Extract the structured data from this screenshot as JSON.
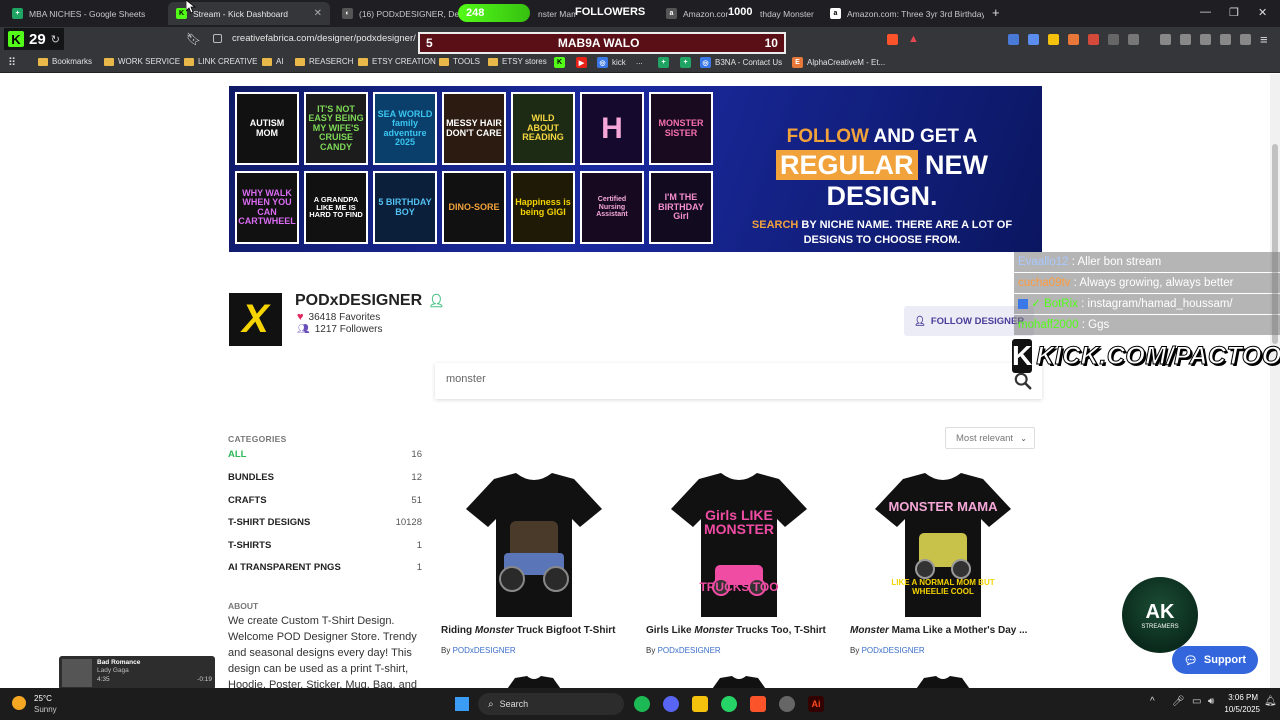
{
  "browser": {
    "tabs": [
      {
        "title": "MBA NICHES - Google Sheets",
        "favicon_color": "#1fa463",
        "favicon_glyph": "+"
      },
      {
        "title": "Stream - Kick Dashboard",
        "favicon_color": "#53fc18",
        "favicon_glyph": "K",
        "active": true
      },
      {
        "title": "(16) PODxDESIGNER, Designer",
        "favicon_color": "#555555",
        "favicon_glyph": "◐"
      },
      {
        "title": "nster Mama",
        "favicon_color": "",
        "favicon_glyph": ""
      },
      {
        "title": "Amazon.com",
        "favicon_color": "#555555",
        "favicon_glyph": "a"
      },
      {
        "title": "thday Monster",
        "favicon_color": "",
        "favicon_glyph": ""
      },
      {
        "title": "Amazon.com: Three 3yr 3rd Birthday",
        "favicon_color": "#ffffff",
        "favicon_glyph": "a"
      }
    ],
    "new_tab_label": "+",
    "url": "creativefabrica.com/designer/podxdesigner/",
    "bookmarks": [
      {
        "label": "Bookmarks",
        "type": "folder"
      },
      {
        "label": "WORK SERVICE",
        "type": "folder"
      },
      {
        "label": "LINK CREATIVE",
        "type": "folder"
      },
      {
        "label": "AI",
        "type": "folder"
      },
      {
        "label": "REASERCH",
        "type": "folder"
      },
      {
        "label": "ETSY CREATION",
        "type": "folder"
      },
      {
        "label": "TOOLS",
        "type": "folder"
      },
      {
        "label": "ETSY stores",
        "type": "folder"
      },
      {
        "label": "",
        "type": "kick"
      },
      {
        "label": "",
        "type": "youtube"
      },
      {
        "label": "kick",
        "type": "link"
      },
      {
        "label": "...",
        "type": "link"
      },
      {
        "label": "",
        "type": "sheets"
      },
      {
        "label": "B3NA - Contact Us",
        "type": "link"
      },
      {
        "label": "AlphaCreativeM - Et...",
        "type": "link"
      }
    ]
  },
  "stream_overlay": {
    "kick_viewers": "29",
    "followers_count": "248",
    "followers_label": "FOLLOWERS",
    "followers_goal": "1000",
    "score_left": "5",
    "score_title": "MAB9A WALO",
    "score_right": "10",
    "chat": [
      {
        "user": "Evaallo12",
        "message": "Aller bon stream",
        "color": "#a8c8ff"
      },
      {
        "user": "cucha09tv",
        "message": "Always growing, always better",
        "color": "#ff9a3c"
      },
      {
        "user": "BotRix",
        "message": "instagram/hamad_houssam/",
        "color": "#53fc18"
      },
      {
        "user": "mohaff2000",
        "message": "Ggs",
        "color": "#53fc18"
      }
    ],
    "kick_channel": "KICK.COM/PACTOO",
    "ak_logo_text": "AK",
    "ak_logo_sub": "STREAMERS"
  },
  "banner": {
    "tiles": [
      "AUTISM MOM",
      "IT'S NOT EASY BEING MY WIFE'S CRUISE CANDY",
      "SEA WORLD family adventure 2025",
      "MESSY HAIR DON'T CARE",
      "WILD ABOUT READING",
      "H",
      "MONSTER SISTER",
      "WHY WALK WHEN YOU CAN CARTWHEEL",
      "A GRANDPA LIKE ME IS HARD TO FIND",
      "5 BIRTHDAY BOY",
      "DINO-SORE",
      "Happiness is being GIGI",
      "Certified Nursing Assistant",
      "I'M THE BIRTHDAY Girl"
    ],
    "line1_highlight": "FOLLOW",
    "line1_rest": " AND GET A",
    "line2_highlight": "REGULAR",
    "line2_rest": " NEW DESIGN.",
    "line3_highlight": "SEARCH",
    "line3_rest": " BY NICHE NAME. THERE ARE A LOT OF DESIGNS TO CHOOSE FROM."
  },
  "designer": {
    "name": "PODxDESIGNER",
    "favorites": "36418 Favorites",
    "followers": "1217 Followers",
    "follow_button": "FOLLOW DESIGNER"
  },
  "search": {
    "value": "monster",
    "placeholder": "Search"
  },
  "categories": {
    "title": "CATEGORIES",
    "items": [
      {
        "label": "ALL",
        "count": "16",
        "active": true
      },
      {
        "label": "BUNDLES",
        "count": "12"
      },
      {
        "label": "CRAFTS",
        "count": "51"
      },
      {
        "label": "T-SHIRT DESIGNS",
        "count": "10128"
      },
      {
        "label": "T-SHIRTS",
        "count": "1"
      },
      {
        "label": "AI TRANSPARENT PNGS",
        "count": "1"
      }
    ]
  },
  "about": {
    "title": "ABOUT",
    "text": "We create Custom T-Shirt Design. Welcome POD Designer Store. Trendy and seasonal designs every day! This design can be used as a print T-shirt, Hoodie, Poster, Sticker, Mug, Bag, and"
  },
  "sort": {
    "selected": "Most relevant"
  },
  "products": [
    {
      "title_pre": "Riding ",
      "title_em": "Monster",
      "title_post": " Truck Bigfoot T-Shirt",
      "by_label": "By ",
      "by": "PODxDESIGNER",
      "print": [
        "",
        ""
      ]
    },
    {
      "title_pre": "Girls Like ",
      "title_em": "Monster",
      "title_post": " Trucks Too, T-Shirt",
      "by_label": "By ",
      "by": "PODxDESIGNER",
      "print": [
        "Girls LIKE MONSTER",
        "TRUCKS TOO"
      ]
    },
    {
      "title_pre": "",
      "title_em": "Monster",
      "title_post": " Mama Like a Mother's Day ...",
      "by_label": "By ",
      "by": "PODxDESIGNER",
      "print": [
        "MONSTER MAMA",
        "LIKE A NORMAL MOM BUT WHEELIE COOL"
      ]
    }
  ],
  "support_label": "Support",
  "music": {
    "title": "Bad Romance",
    "artist": "Lady Gaga",
    "elapsed": "4:35",
    "duration": "-0:19"
  },
  "taskbar": {
    "temperature": "25°C",
    "weather": "Sunny",
    "search_label": "Search",
    "time": "3:06 PM",
    "date": "10/5/2025"
  },
  "colors": {
    "kick_green": "#53fc18",
    "accent_orange": "#f2a23b",
    "link_blue": "#3b6ec9",
    "banner_navy": "#1a2aa0",
    "score_maroon": "#5a0e16"
  }
}
